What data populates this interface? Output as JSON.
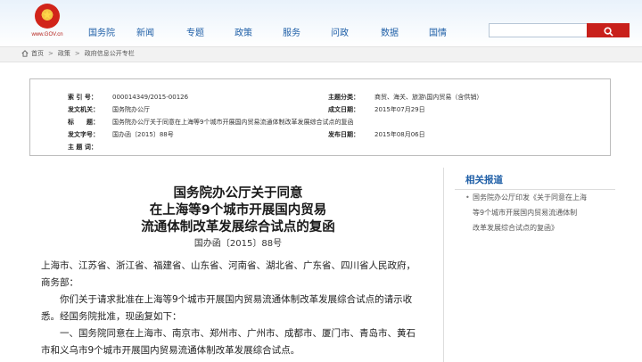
{
  "logo": {
    "site_text": "www.GOV.cn"
  },
  "nav": {
    "items": [
      "国务院",
      "新闻",
      "专题",
      "政策",
      "服务",
      "问政",
      "数据",
      "国情"
    ]
  },
  "search": {
    "value": "",
    "placeholder": ""
  },
  "breadcrumb": {
    "items": [
      "首页",
      "政策",
      "政府信息公开专栏"
    ],
    "separator": ">"
  },
  "meta": {
    "index_no_label": "索 引 号：",
    "index_no": "000014349/2015-00126",
    "subject_label": "主题分类：",
    "subject": "商贸、海关、旅游\\国内贸易（含供销）",
    "issuer_label": "发文机关：",
    "issuer": "国务院办公厅",
    "written_date_label": "成文日期：",
    "written_date": "2015年07月29日",
    "title_label": "标　　题：",
    "title": "国务院办公厅关于同意在上海等9个城市开展国内贸易流通体制改革发展综合试点的复函",
    "doc_no_label": "发文字号：",
    "doc_no": "国办函〔2015〕88号",
    "publish_date_label": "发布日期：",
    "publish_date": "2015年08月06日",
    "topic_label": "主 题 词："
  },
  "article": {
    "title_lines": [
      "国务院办公厅关于同意",
      "在上海等9个城市开展国内贸易",
      "流通体制改革发展综合试点的复函"
    ],
    "doc_no": "国办函〔2015〕88号",
    "paragraph_lines": [
      "上海市、江苏省、浙江省、福建省、山东省、河南省、湖北省、广东省、四川省人民政府，",
      "商务部：",
      "　　你们关于请求批准在上海等9个城市开展国内贸易流通体制改革发展综合试点的请示收",
      "悉。经国务院批准，现函复如下：",
      "　　一、国务院同意在上海市、南京市、郑州市、广州市、成都市、厦门市、青岛市、黄石",
      "市和义乌市9个城市开展国内贸易流通体制改革发展综合试点。"
    ]
  },
  "related": {
    "title": "相关报道",
    "links": [
      "国务院办公厅印发《关于同意在上海",
      "等9个城市开展国内贸易流通体制",
      "改革发展综合试点的复函》"
    ]
  },
  "colors": {
    "nav_link": "#1f5fa7",
    "search_button": "#c8201b",
    "related_title": "#1f5fa7"
  }
}
